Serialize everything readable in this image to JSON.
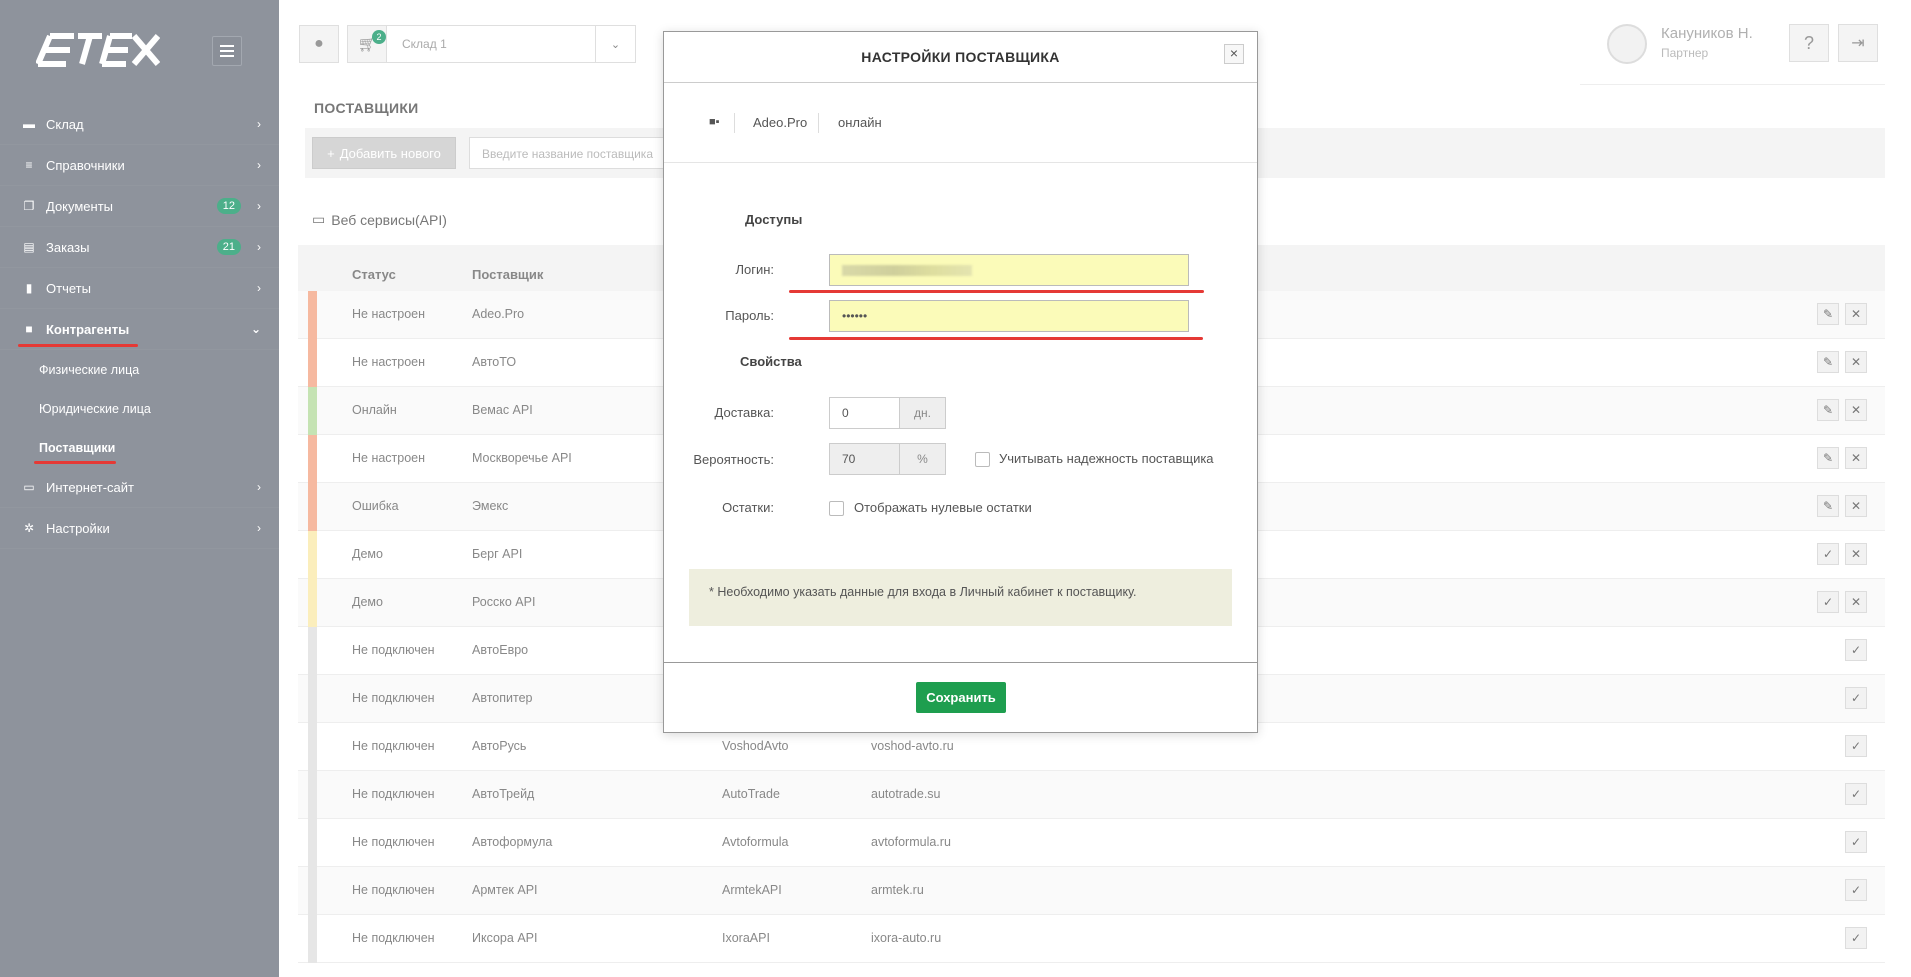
{
  "sidebar": {
    "logo": "ETEX",
    "items": [
      {
        "label": "Склад",
        "icon": "warehouse-icon",
        "badge": null
      },
      {
        "label": "Справочники",
        "icon": "database-icon",
        "badge": null
      },
      {
        "label": "Документы",
        "icon": "documents-icon",
        "badge": "12"
      },
      {
        "label": "Заказы",
        "icon": "orders-icon",
        "badge": "21"
      },
      {
        "label": "Отчеты",
        "icon": "bar-chart-icon",
        "badge": null
      },
      {
        "label": "Контрагенты",
        "icon": "briefcase-icon",
        "badge": null
      },
      {
        "label": "Интернет-сайт",
        "icon": "monitor-icon",
        "badge": null
      },
      {
        "label": "Настройки",
        "icon": "gear-icon",
        "badge": null
      }
    ],
    "subitems": [
      "Физические лица",
      "Юридические лица",
      "Поставщики"
    ]
  },
  "topbar": {
    "cart_count": "2",
    "store_value": "Склад 1",
    "user_name": "Кануников Н.",
    "user_role": "Партнер",
    "help_icon": "?"
  },
  "page": {
    "title": "ПОСТАВЩИКИ",
    "add_button": "Добавить нового",
    "search_placeholder": "Введите название поставщика",
    "section_title": "Веб сервисы(API)",
    "columns": {
      "status": "Статус",
      "supplier": "Поставщик"
    },
    "rows": [
      {
        "status": "Не настроен",
        "supplier": "Adeo.Pro",
        "code": "",
        "site": "",
        "color": "#f6b9a0",
        "actions": [
          "edit",
          "delete"
        ]
      },
      {
        "status": "Не настроен",
        "supplier": "АвтоТО",
        "code": "",
        "site": "",
        "color": "#f6b9a0",
        "actions": [
          "edit",
          "delete"
        ]
      },
      {
        "status": "Онлайн",
        "supplier": "Вемас API",
        "code": "",
        "site": "",
        "color": "#c5e3b3",
        "actions": [
          "edit",
          "delete"
        ]
      },
      {
        "status": "Не настроен",
        "supplier": "Москворечье API",
        "code": "",
        "site": "",
        "color": "#f6b9a0",
        "actions": [
          "edit",
          "delete"
        ]
      },
      {
        "status": "Ошибка",
        "supplier": "Эмекс",
        "code": "",
        "site": "",
        "color": "#f6b9a0",
        "actions": [
          "edit",
          "delete"
        ]
      },
      {
        "status": "Демо",
        "supplier": "Берг API",
        "code": "",
        "site": "",
        "color": "#fbeebc",
        "actions": [
          "check",
          "delete"
        ]
      },
      {
        "status": "Демо",
        "supplier": "Росско API",
        "code": "",
        "site": "",
        "color": "#fbeebc",
        "actions": [
          "check",
          "delete"
        ]
      },
      {
        "status": "Не подключен",
        "supplier": "АвтоЕвро",
        "code": "",
        "site": "",
        "color": "#e6e6e6",
        "actions": [
          "check"
        ]
      },
      {
        "status": "Не подключен",
        "supplier": "Автопитер",
        "code": "",
        "site": "",
        "color": "#e6e6e6",
        "actions": [
          "check"
        ]
      },
      {
        "status": "Не подключен",
        "supplier": "АвтоРусь",
        "code": "VoshodAvto",
        "site": "voshod-avto.ru",
        "color": "#e6e6e6",
        "actions": [
          "check"
        ]
      },
      {
        "status": "Не подключен",
        "supplier": "АвтоТрейд",
        "code": "AutoTrade",
        "site": "autotrade.su",
        "color": "#e6e6e6",
        "actions": [
          "check"
        ]
      },
      {
        "status": "Не подключен",
        "supplier": "Автоформула",
        "code": "Avtoformula",
        "site": "avtoformula.ru",
        "color": "#e6e6e6",
        "actions": [
          "check"
        ]
      },
      {
        "status": "Не подключен",
        "supplier": "Армтек API",
        "code": "ArmtekAPI",
        "site": "armtek.ru",
        "color": "#e6e6e6",
        "actions": [
          "check"
        ]
      },
      {
        "status": "Не подключен",
        "supplier": "Иксора API",
        "code": "IxoraAPI",
        "site": "ixora-auto.ru",
        "color": "#e6e6e6",
        "actions": [
          "check"
        ]
      }
    ]
  },
  "modal": {
    "title": "НАСТРОЙКИ ПОСТАВЩИКА",
    "supplier_name": "Adeo.Pro",
    "supplier_status": "онлайн",
    "access_heading": "Доступы",
    "login_label": "Логин:",
    "password_label": "Пароль:",
    "password_value": "••••••",
    "props_heading": "Свойства",
    "delivery_label": "Доставка:",
    "delivery_value": "0",
    "delivery_unit": "дн.",
    "probability_label": "Вероятность:",
    "probability_value": "70",
    "probability_unit": "%",
    "reliability_checkbox": "Учитывать надежность поставщика",
    "stock_label": "Остатки:",
    "zero_stock_checkbox": "Отображать нулевые остатки",
    "note": "* Необходимо указать данные для входа в Личный кабинет к поставщику.",
    "save_button": "Сохранить"
  }
}
